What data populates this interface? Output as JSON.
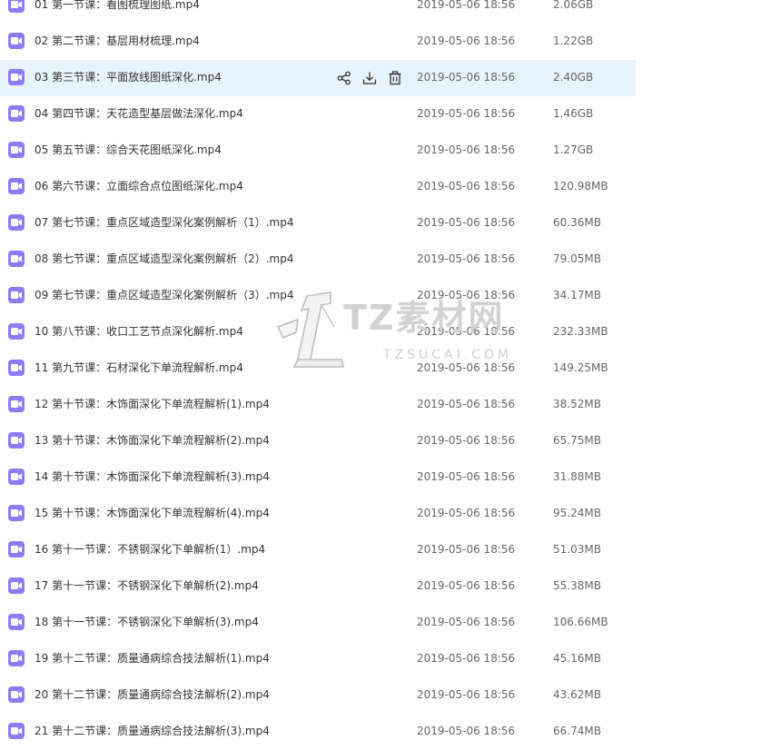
{
  "files": [
    {
      "name": "01 第一节课：看图梳理图纸.mp4",
      "date": "2019-05-06 18:56",
      "size": "2.06GB"
    },
    {
      "name": "02 第二节课：基层用材梳理.mp4",
      "date": "2019-05-06 18:56",
      "size": "1.22GB"
    },
    {
      "name": "03 第三节课：平面放线图纸深化.mp4",
      "date": "2019-05-06 18:56",
      "size": "2.40GB"
    },
    {
      "name": "04 第四节课：天花造型基层做法深化.mp4",
      "date": "2019-05-06 18:56",
      "size": "1.46GB"
    },
    {
      "name": "05 第五节课：综合天花图纸深化.mp4",
      "date": "2019-05-06 18:56",
      "size": "1.27GB"
    },
    {
      "name": "06 第六节课：立面综合点位图纸深化.mp4",
      "date": "2019-05-06 18:56",
      "size": "120.98MB"
    },
    {
      "name": "07 第七节课：重点区域造型深化案例解析（1）.mp4",
      "date": "2019-05-06 18:56",
      "size": "60.36MB"
    },
    {
      "name": "08 第七节课：重点区域造型深化案例解析（2）.mp4",
      "date": "2019-05-06 18:56",
      "size": "79.05MB"
    },
    {
      "name": "09 第七节课：重点区域造型深化案例解析（3）.mp4",
      "date": "2019-05-06 18:56",
      "size": "34.17MB"
    },
    {
      "name": "10 第八节课：收口工艺节点深化解析.mp4",
      "date": "2019-05-06 18:56",
      "size": "232.33MB"
    },
    {
      "name": "11 第九节课：石材深化下单流程解析.mp4",
      "date": "2019-05-06 18:56",
      "size": "149.25MB"
    },
    {
      "name": "12 第十节课：木饰面深化下单流程解析(1).mp4",
      "date": "2019-05-06 18:56",
      "size": "38.52MB"
    },
    {
      "name": "13 第十节课：木饰面深化下单流程解析(2).mp4",
      "date": "2019-05-06 18:56",
      "size": "65.75MB"
    },
    {
      "name": "14 第十节课：木饰面深化下单流程解析(3).mp4",
      "date": "2019-05-06 18:56",
      "size": "31.88MB"
    },
    {
      "name": "15 第十节课：木饰面深化下单流程解析(4).mp4",
      "date": "2019-05-06 18:56",
      "size": "95.24MB"
    },
    {
      "name": "16 第十一节课：不锈钢深化下单解析(1）.mp4",
      "date": "2019-05-06 18:56",
      "size": "51.03MB"
    },
    {
      "name": "17 第十一节课：不锈钢深化下单解析(2).mp4",
      "date": "2019-05-06 18:56",
      "size": "55.38MB"
    },
    {
      "name": "18 第十一节课：不锈钢深化下单解析(3).mp4",
      "date": "2019-05-06 18:56",
      "size": "106.66MB"
    },
    {
      "name": "19 第十二节课：质量通病综合技法解析(1).mp4",
      "date": "2019-05-06 18:56",
      "size": "45.16MB"
    },
    {
      "name": "20 第十二节课：质量通病综合技法解析(2).mp4",
      "date": "2019-05-06 18:56",
      "size": "43.62MB"
    },
    {
      "name": "21 第十二节课：质量通病综合技法解析(3).mp4",
      "date": "2019-05-06 18:56",
      "size": "66.74MB"
    }
  ],
  "hovered_index": 2,
  "row_actions": {
    "share_icon": "share-icon",
    "download_icon": "download-icon",
    "delete_icon": "trash-icon"
  },
  "watermark": {
    "title": "TZ素材网",
    "subtitle": "TZSUCAI.COM"
  },
  "colors": {
    "icon": "#8b7cf6",
    "hover_row": "#e8f4fd"
  }
}
